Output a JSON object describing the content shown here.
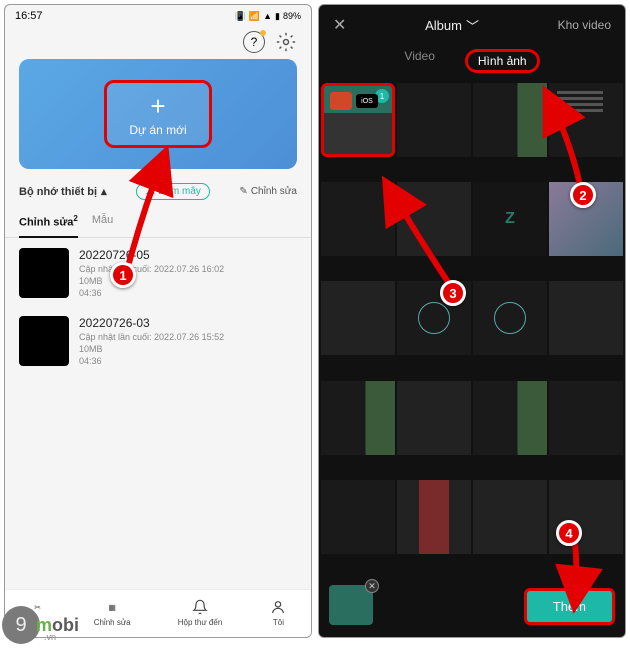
{
  "left": {
    "status": {
      "time": "16:57",
      "battery": "89%"
    },
    "new_project": {
      "label": "Dự án mới"
    },
    "storage_label": "Bộ nhớ thiết bị",
    "cloud_btn": "Đám mây",
    "edit_btn": "Chỉnh sửa",
    "tabs": {
      "active": "Chỉnh sửa",
      "active_count": "2",
      "other": "Mẫu"
    },
    "projects": [
      {
        "title": "20220726-05",
        "updated": "Cập nhật lần cuối: 2022.07.26 16:02",
        "size": "10MB",
        "duration": "04:36"
      },
      {
        "title": "20220726-03",
        "updated": "Cập nhật lần cuối: 2022.07.26 15:52",
        "size": "10MB",
        "duration": "04:36"
      }
    ],
    "bottom_nav": {
      "edit": "Chỉnh sửa",
      "inbox": "Hộp thư đến",
      "me": "Tôi"
    }
  },
  "right": {
    "dropdown": "Album",
    "stock": "Kho video",
    "tabs": {
      "video": "Video",
      "image": "Hình ảnh"
    },
    "selected_badge": "1",
    "add_btn": "Thêm"
  },
  "markers": {
    "m1": "1",
    "m2": "2",
    "m3": "3",
    "m4": "4"
  },
  "watermark": {
    "brand_a": "m",
    "brand_b": "obi",
    "suffix": ".vn",
    "nine": "9"
  }
}
